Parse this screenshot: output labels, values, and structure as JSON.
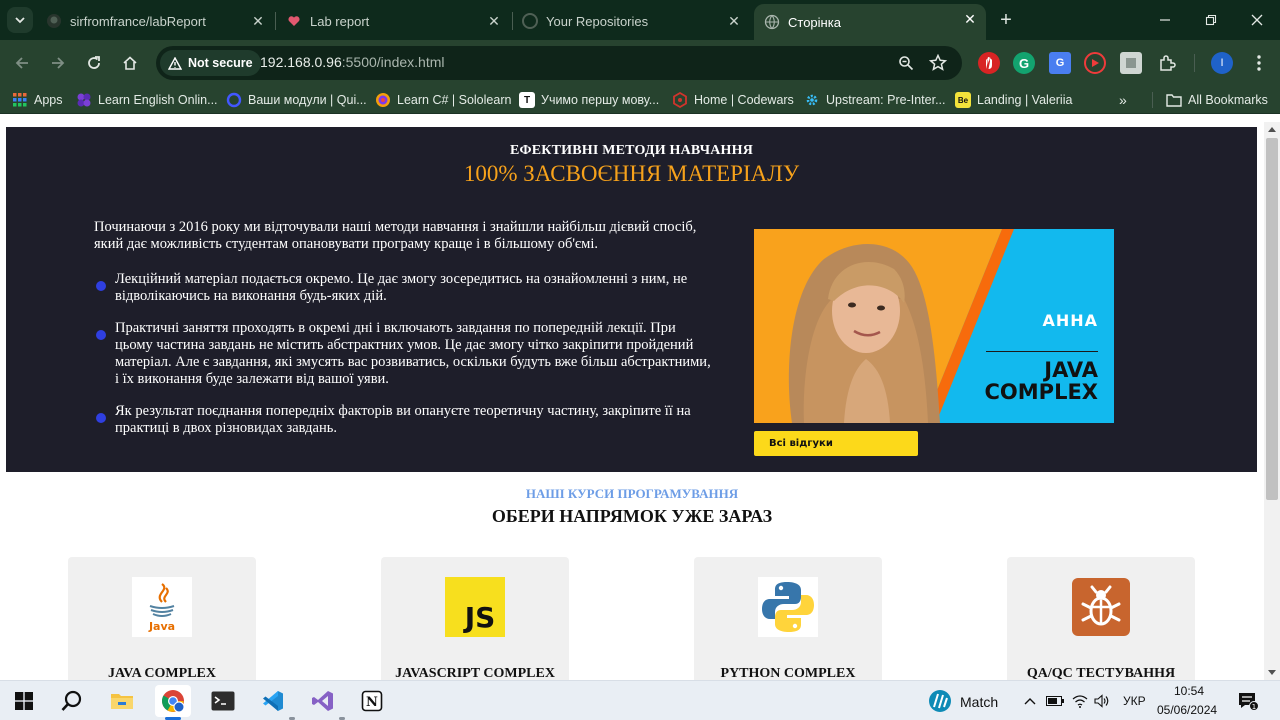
{
  "browser": {
    "tabs": [
      {
        "title": "sirfromfrance/labReport",
        "favicon": "github-icon",
        "active": false
      },
      {
        "title": "Lab report",
        "favicon": "heart-icon",
        "active": false
      },
      {
        "title": "Your Repositories",
        "favicon": "github-icon",
        "active": false
      },
      {
        "title": "Сторінка",
        "favicon": "globe-icon",
        "active": true
      }
    ],
    "security_label": "Not secure",
    "url_host": "192.168.0.96",
    "url_rest": ":5500/index.html",
    "bookmarks": [
      {
        "label": "Apps",
        "icon": "apps-grid-icon"
      },
      {
        "label": "Learn English Onlin...",
        "icon": "flower-icon"
      },
      {
        "label": "Ваши модули | Qui...",
        "icon": "quizlet-icon"
      },
      {
        "label": "Learn C# | Sololearn",
        "icon": "sololearn-icon"
      },
      {
        "label": "Учимо першу мову...",
        "icon": "t-icon"
      },
      {
        "label": "Home | Codewars",
        "icon": "codewars-icon"
      },
      {
        "label": "Upstream: Pre-Inter...",
        "icon": "gear-icon"
      },
      {
        "label": "Landing | Valeriia",
        "icon": "be-icon"
      }
    ],
    "all_bookmarks_label": "All Bookmarks"
  },
  "hero": {
    "kicker": "ЕФЕКТИВНІ МЕТОДИ НАВЧАННЯ",
    "title": "100% ЗАСВОЄННЯ МАТЕРІАЛУ",
    "intro": "Починаючи з 2016 року ми відточували наші методи навчання і знайшли найбільш дієвий спосіб, який дає можливість студентам опановувати програму краще і в більшому об'ємі.",
    "points": [
      "Лекційний матеріал подається окремо. Це дає змогу зосередитись на ознайомленні з ним, не відволікаючись на виконання будь-яких дій.",
      "Практичні заняття проходять в окремі дні і включають завдання по попередній лекції. При цьому частина завдань не містить абстрактних умов. Це дає змогу чітко закріпити пройдений матеріал. Але є завдання, які змусять вас розвиватись, оскільки будуть вже більш абстрактними, і їх виконання буде залежати від вашої уяви.",
      "Як результат поєднання попередніх факторів ви опануєте теоретичну частину, закріпите її на практиці в двох різновидах завдань."
    ],
    "promo": {
      "name": "АННА",
      "title_line1": "JAVA",
      "title_line2": "COMPLEX"
    },
    "reviews_button": "Всі відгуки"
  },
  "courses": {
    "kicker": "НАШІ КУРСИ ПРОГРАМУВАННЯ",
    "title": "ОБЕРИ НАПРЯМОК УЖЕ ЗАРАЗ",
    "items": [
      {
        "label": "JAVA COMPLEX",
        "icon": "java-logo-icon"
      },
      {
        "label": "JAVASCRIPT COMPLEX",
        "icon": "javascript-logo-icon"
      },
      {
        "label": "PYTHON COMPLEX",
        "icon": "python-logo-icon"
      },
      {
        "label": "QA/QC ТЕСТУВАННЯ",
        "icon": "bug-icon"
      }
    ]
  },
  "taskbar": {
    "weather_label": "Match",
    "language": "УКР",
    "time": "10:54",
    "date": "05/06/2024"
  },
  "colors": {
    "hero_bg": "#1e1e2a",
    "accent_orange": "#f7a21b",
    "bullet_blue": "#2f3fe0",
    "button_yellow": "#fcd91a",
    "courses_kicker": "#6d9de6"
  }
}
